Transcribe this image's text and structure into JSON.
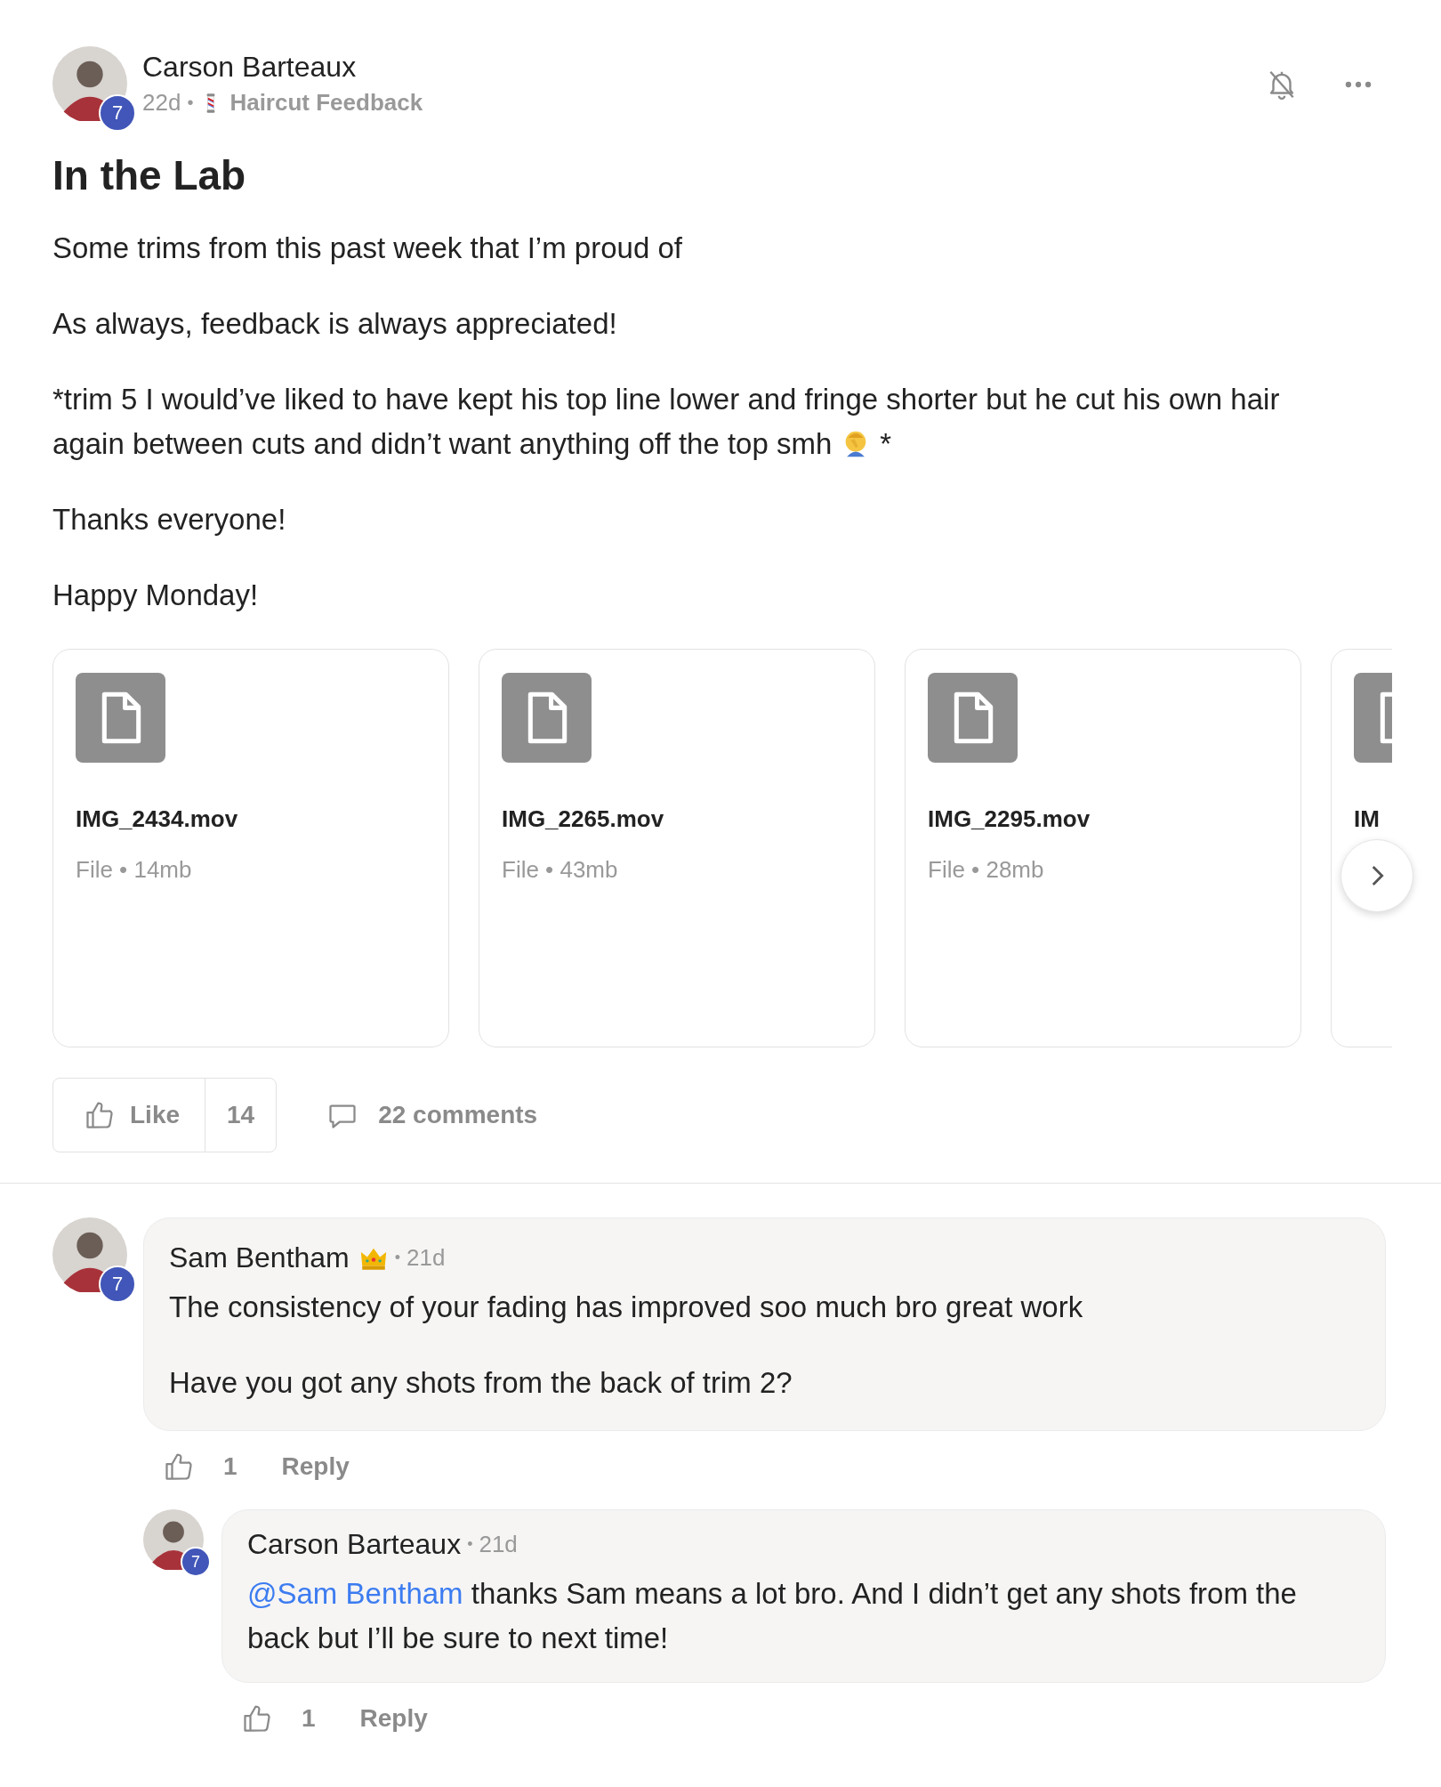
{
  "post": {
    "author": {
      "name": "Carson Barteaux",
      "badge": "7"
    },
    "time": "22d",
    "separator": "•",
    "category": {
      "label": "Haircut Feedback"
    },
    "title": "In the Lab",
    "paragraphs": [
      {
        "text": "Some trims from this past week that I’m proud of"
      },
      {
        "text": "As always, feedback is always appreciated!"
      },
      {
        "lines": [
          "*trim 5 I would’ve liked to have kept his top line lower and fringe shorter but he cut his own hair",
          "again between cuts and didn’t want anything off the top smh"
        ],
        "emoji": true,
        "tail": "*"
      },
      {
        "text": "Thanks everyone!"
      },
      {
        "text": "Happy Monday!"
      }
    ],
    "attachments": [
      {
        "name": "IMG_2434.mov",
        "meta": "File • 14mb"
      },
      {
        "name": "IMG_2265.mov",
        "meta": "File • 43mb"
      },
      {
        "name": "IMG_2295.mov",
        "meta": "File • 28mb"
      },
      {
        "name": "IM"
      }
    ],
    "like": {
      "label": "Like",
      "count": "14"
    },
    "comments_label": "22 comments"
  },
  "comments": [
    {
      "author": "Sam Bentham",
      "badge": "7",
      "crown": true,
      "separator": "•",
      "time": "21d",
      "paragraphs": [
        {
          "text": "The consistency of your fading has improved soo much bro great work"
        },
        {
          "text": "Have you got any shots from the back of trim 2?"
        }
      ],
      "likes": "1",
      "reply_label": "Reply",
      "replies": [
        {
          "author": "Carson Barteaux",
          "badge": "7",
          "crown": false,
          "separator": "•",
          "time": "21d",
          "paragraphs": [
            {
              "mention": "@Sam Bentham",
              "text": " thanks Sam means a lot bro. And I didn’t get any shots from the back but I’ll be sure to next time!"
            }
          ],
          "likes": "1",
          "reply_label": "Reply"
        }
      ]
    }
  ]
}
